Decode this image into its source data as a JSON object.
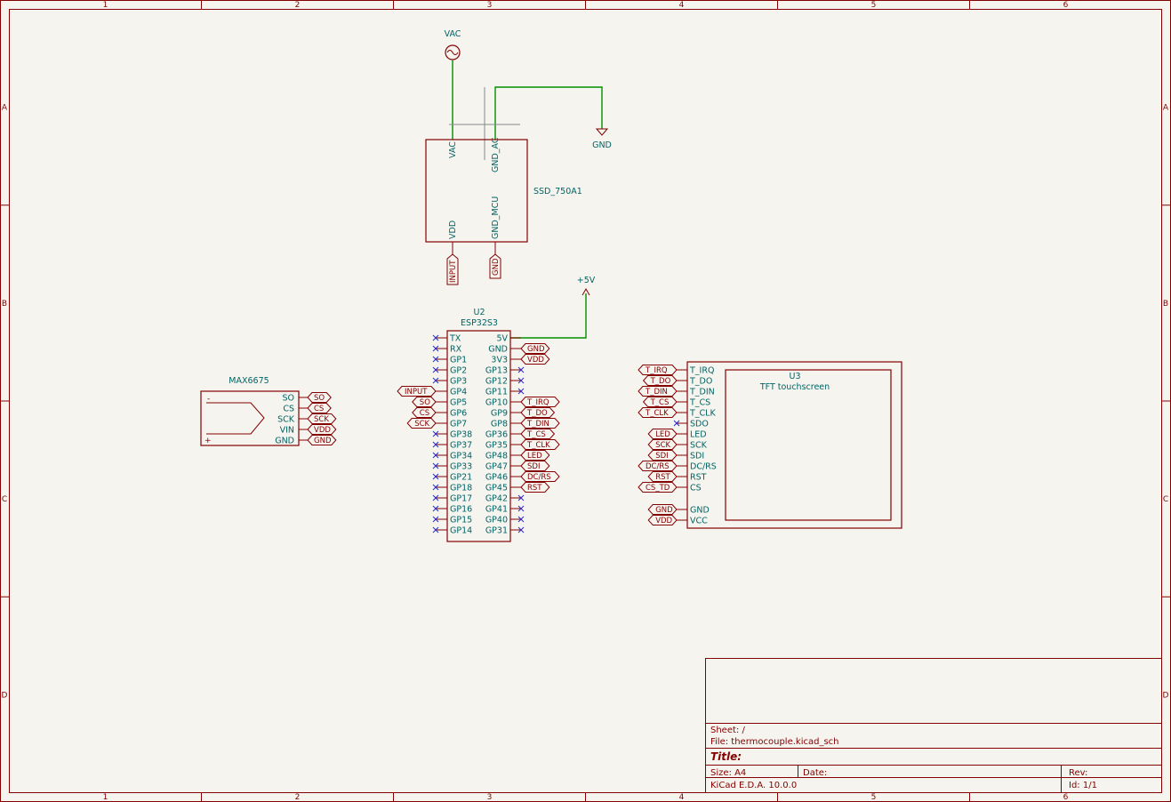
{
  "frame": {
    "columns": [
      "1",
      "2",
      "3",
      "4",
      "5",
      "6"
    ],
    "rows": [
      "A",
      "B",
      "C",
      "D"
    ]
  },
  "title_block": {
    "sheet": "Sheet: /",
    "file": "File: thermocouple.kicad_sch",
    "title": "Title:",
    "size": "Size: A4",
    "date": "Date:",
    "rev": "Rev:",
    "kicad": "KiCad E.D.A. 10.0.0",
    "id": "Id: 1/1"
  },
  "power": {
    "vac": "VAC",
    "gnd": "GND",
    "plus5v": "+5V"
  },
  "ssd": {
    "value": "SSD_750A1",
    "pins": {
      "vac": "VAC",
      "gnd_ac": "GND_AC",
      "vdd": "VDD",
      "gnd_mcu": "GND_MCU"
    },
    "labels": {
      "input": "INPUT",
      "gnd": "GND"
    }
  },
  "max6675": {
    "value": "MAX6675",
    "pins": [
      "SO",
      "CS",
      "SCK",
      "VIN",
      "GND"
    ],
    "labels": [
      "SO",
      "CS",
      "SCK",
      "VDD",
      "GND"
    ],
    "minus": "-",
    "plus": "+"
  },
  "u2": {
    "ref": "U2",
    "value": "ESP32S3",
    "left_pins": [
      "TX",
      "RX",
      "GP1",
      "GP2",
      "GP3",
      "GP4",
      "GP5",
      "GP6",
      "GP7",
      "GP38",
      "GP37",
      "GP34",
      "GP33",
      "GP21",
      "GP18",
      "GP17",
      "GP16",
      "GP15",
      "GP14"
    ],
    "right_pins": [
      "5V",
      "GND",
      "3V3",
      "GP13",
      "GP12",
      "GP11",
      "GP10",
      "GP9",
      "GP8",
      "GP36",
      "GP35",
      "GP48",
      "GP47",
      "GP46",
      "GP45",
      "GP42",
      "GP41",
      "GP40",
      "GP31"
    ],
    "left_labels": [
      "",
      "",
      "",
      "",
      "",
      "INPUT",
      "SO",
      "CS",
      "SCK",
      "",
      "",
      "",
      "",
      "",
      "",
      "",
      "",
      "",
      ""
    ],
    "right_labels": [
      "",
      "GND",
      "VDD",
      "",
      "",
      "",
      "T_IRQ",
      "T_DO",
      "T_DIN",
      "T_CS",
      "T_CLK",
      "LED",
      "SDI",
      "DC/RS",
      "RST",
      "",
      "",
      "",
      ""
    ]
  },
  "u3": {
    "ref": "U3",
    "value": "TFT touchscreen",
    "pins": [
      "T_IRQ",
      "T_DO",
      "T_DIN",
      "T_CS",
      "T_CLK",
      "SDO",
      "LED",
      "SCK",
      "SDI",
      "DC/RS",
      "RST",
      "CS",
      "GND",
      "VCC"
    ],
    "labels": [
      "T_IRQ",
      "T_DO",
      "T_DIN",
      "T_CS",
      "T_CLK",
      "",
      "LED",
      "SCK",
      "SDI",
      "DC/RS",
      "RST",
      "CS_TD",
      "GND",
      "VDD"
    ]
  }
}
